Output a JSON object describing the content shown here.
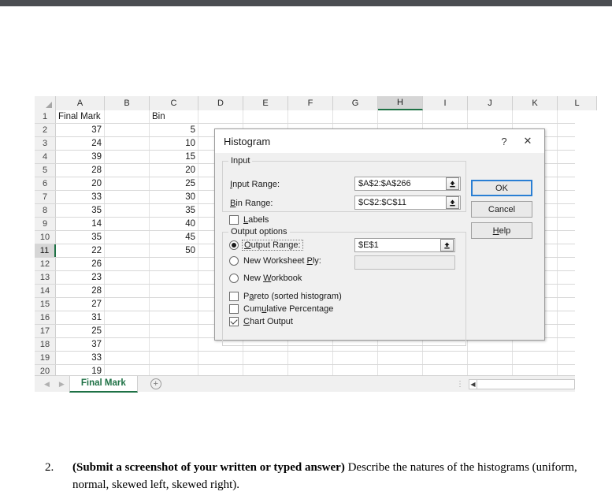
{
  "spreadsheet": {
    "columns": [
      "A",
      "B",
      "C",
      "D",
      "E",
      "F",
      "G",
      "H",
      "I",
      "J",
      "K",
      "L"
    ],
    "active_column": "H",
    "active_row": 11,
    "rows": [
      {
        "num": "1",
        "a": "Final Mark",
        "b": "",
        "c": "Bin"
      },
      {
        "num": "2",
        "a": "37",
        "b": "",
        "c": "5"
      },
      {
        "num": "3",
        "a": "24",
        "b": "",
        "c": "10"
      },
      {
        "num": "4",
        "a": "39",
        "b": "",
        "c": "15"
      },
      {
        "num": "5",
        "a": "28",
        "b": "",
        "c": "20"
      },
      {
        "num": "6",
        "a": "20",
        "b": "",
        "c": "25"
      },
      {
        "num": "7",
        "a": "33",
        "b": "",
        "c": "30"
      },
      {
        "num": "8",
        "a": "35",
        "b": "",
        "c": "35"
      },
      {
        "num": "9",
        "a": "14",
        "b": "",
        "c": "40"
      },
      {
        "num": "10",
        "a": "35",
        "b": "",
        "c": "45"
      },
      {
        "num": "11",
        "a": "22",
        "b": "",
        "c": "50"
      },
      {
        "num": "12",
        "a": "26",
        "b": "",
        "c": ""
      },
      {
        "num": "13",
        "a": "23",
        "b": "",
        "c": ""
      },
      {
        "num": "14",
        "a": "28",
        "b": "",
        "c": ""
      },
      {
        "num": "15",
        "a": "27",
        "b": "",
        "c": ""
      },
      {
        "num": "16",
        "a": "31",
        "b": "",
        "c": ""
      },
      {
        "num": "17",
        "a": "25",
        "b": "",
        "c": ""
      },
      {
        "num": "18",
        "a": "37",
        "b": "",
        "c": ""
      },
      {
        "num": "19",
        "a": "33",
        "b": "",
        "c": ""
      },
      {
        "num": "20",
        "a": "19",
        "b": "",
        "c": ""
      }
    ],
    "tabbar": {
      "prev_icon": "left-arrow-icon",
      "next_icon": "right-arrow-icon",
      "sheet_name": "Final Mark",
      "add_sheet_label": "+",
      "split_handle": "⋮",
      "scroll_left_glyph": "◀"
    }
  },
  "dialog": {
    "title": "Histogram",
    "help_icon_label": "?",
    "close_icon_label": "✕",
    "input_group": {
      "legend": "Input",
      "input_range_label": "Input Range:",
      "input_range_value": "$A$2:$A$266",
      "bin_range_label": "Bin Range:",
      "bin_range_value": "$C$2:$C$11",
      "labels_checkbox": "Labels",
      "labels_checked": false
    },
    "output_group": {
      "legend": "Output options",
      "output_range_label": "Output Range:",
      "output_range_value": "$E$1",
      "output_range_selected": true,
      "new_worksheet_label": "New Worksheet Ply:",
      "new_worksheet_value": "",
      "new_worksheet_selected": false,
      "new_workbook_label": "New Workbook",
      "new_workbook_selected": false,
      "pareto_label": "Pareto (sorted histogram)",
      "pareto_checked": false,
      "cumulative_label": "Cumulative Percentage",
      "cumulative_checked": false,
      "chart_output_label": "Chart Output",
      "chart_output_checked": true
    },
    "buttons": {
      "ok": "OK",
      "cancel": "Cancel",
      "help": "Help"
    }
  },
  "question": {
    "number": "2.",
    "bold_part": "(Submit a screenshot of your written or typed answer)",
    "rest": " Describe the natures of the histograms (uniform, normal, skewed left, skewed right)."
  },
  "colors": {
    "excel_green": "#1e7145",
    "focus_blue": "#2a7fd4",
    "top_strip": "#4b4e52",
    "dialog_bg": "#f0f0f0"
  }
}
